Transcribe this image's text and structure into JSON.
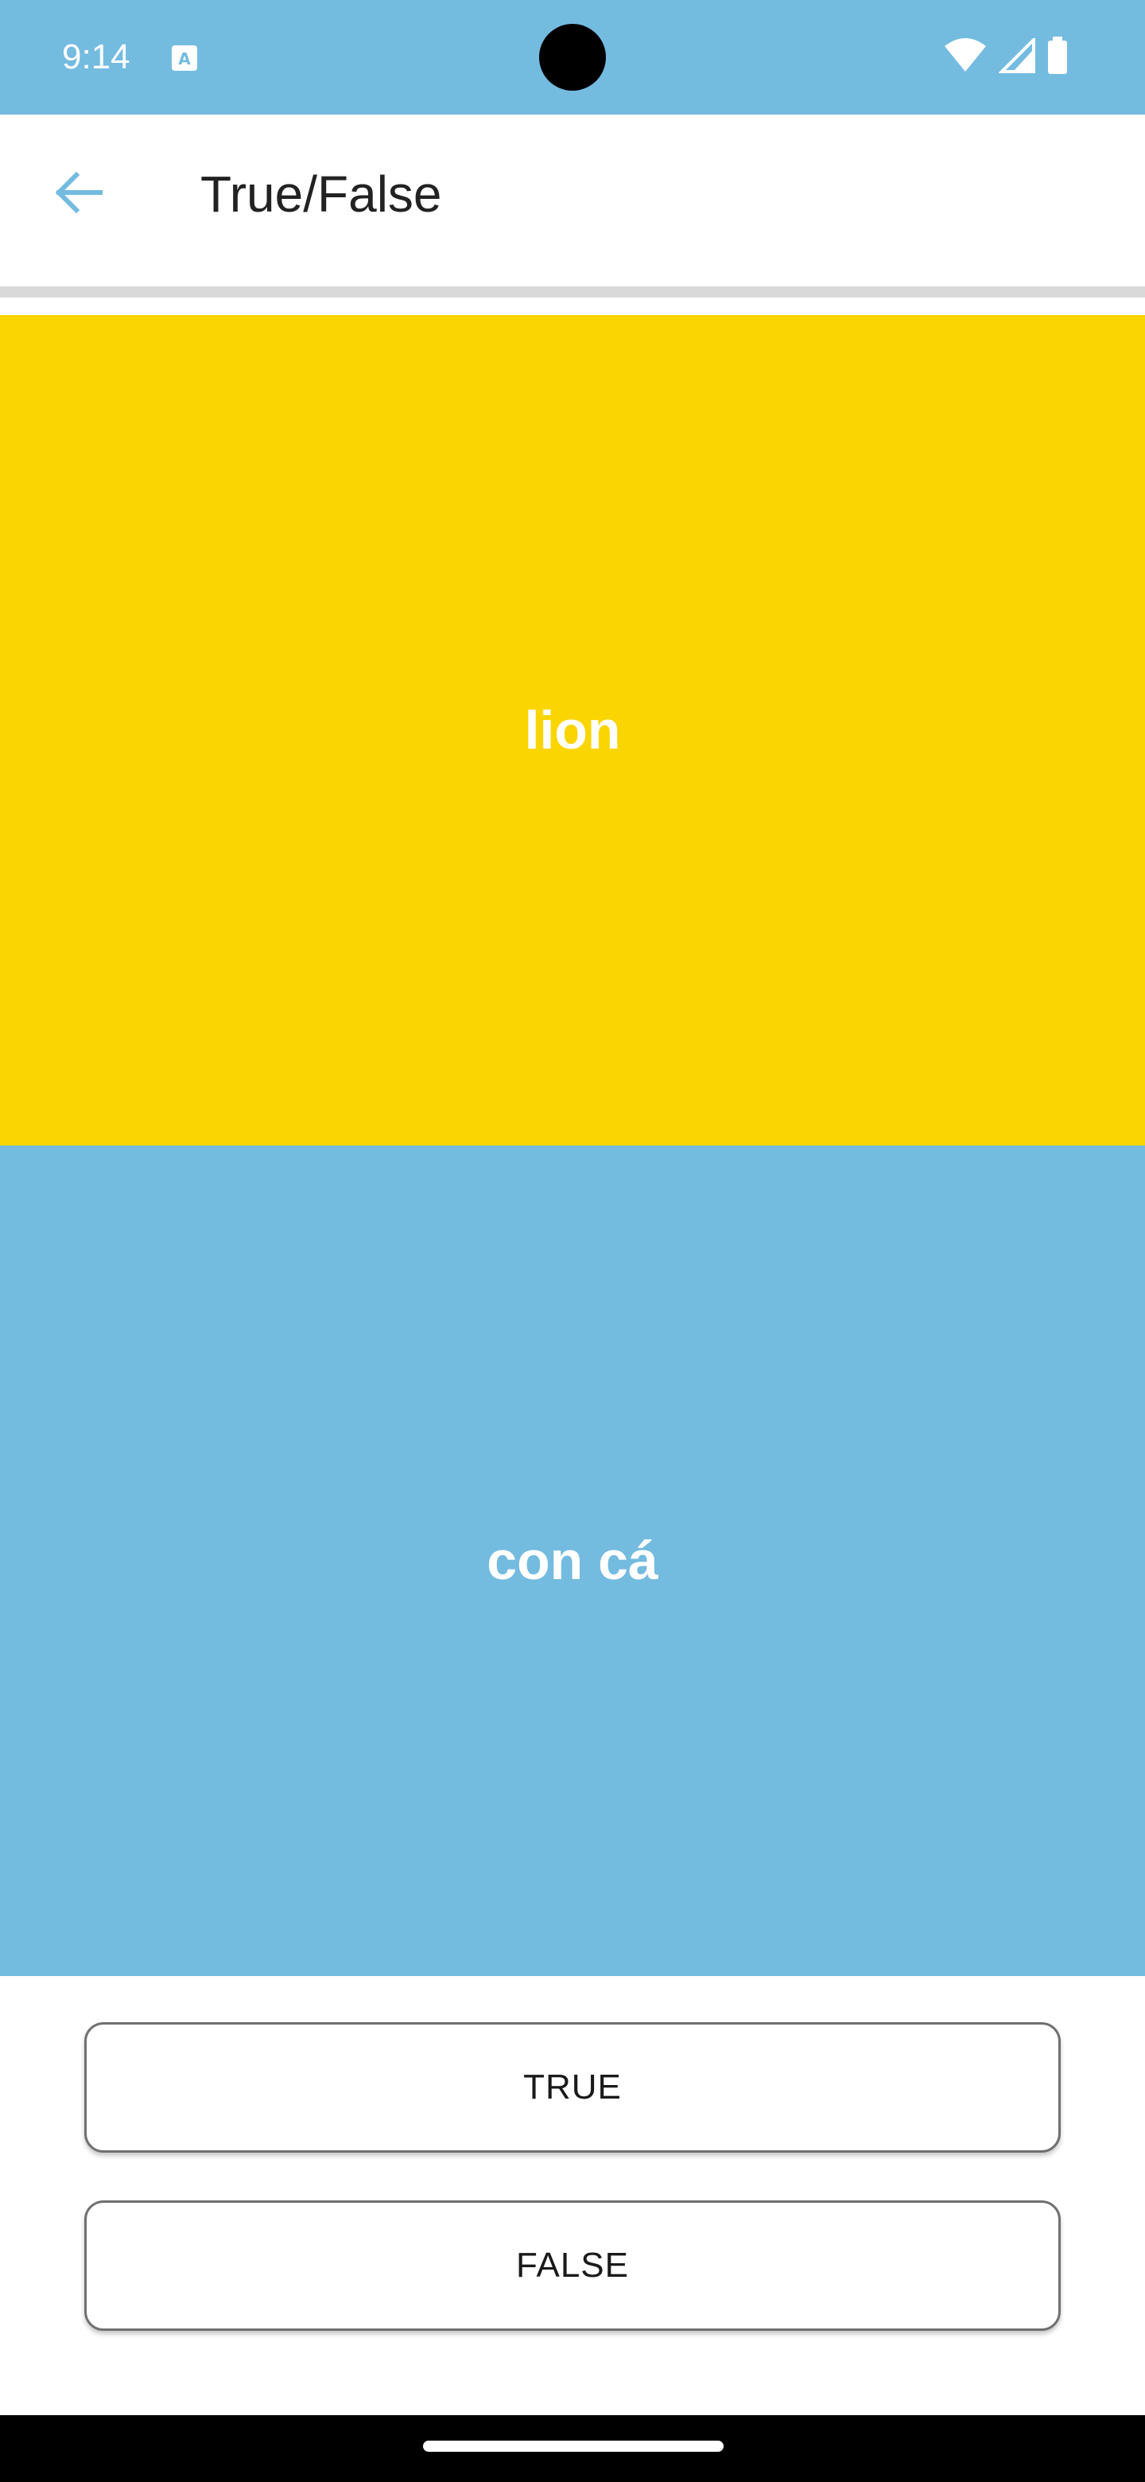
{
  "status_bar": {
    "time": "9:14",
    "icons": [
      "keyboard-app-icon",
      "wifi-icon",
      "cell-signal-icon",
      "battery-icon"
    ]
  },
  "app_bar": {
    "back_icon": "arrow-left-icon",
    "title": "True/False"
  },
  "question": {
    "term": "lion",
    "translation": "con cá"
  },
  "answers": {
    "true_label": "TRUE",
    "false_label": "FALSE"
  },
  "colors": {
    "accent_blue": "#74bbe0",
    "card_yellow": "#fbd500",
    "text_on_card": "#ffffff"
  }
}
